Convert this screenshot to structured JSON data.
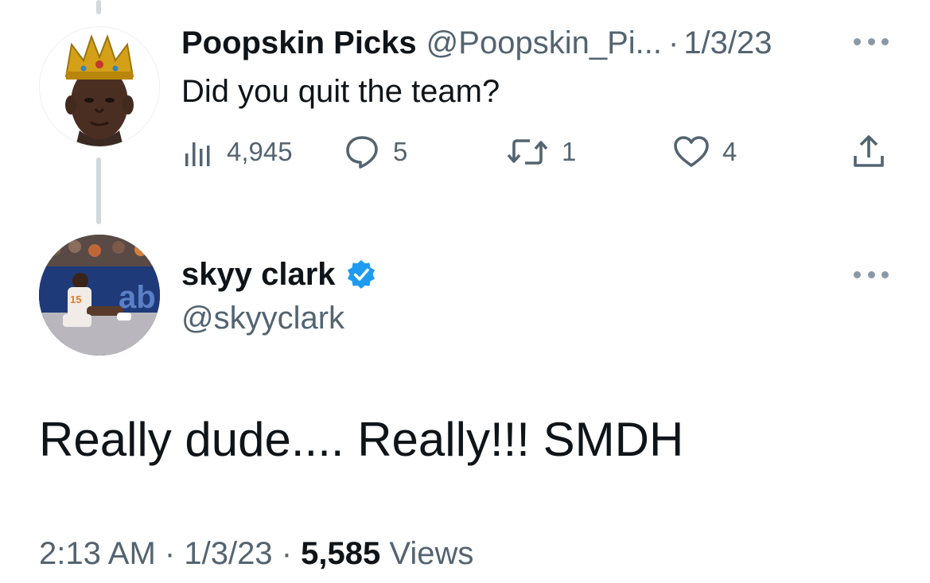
{
  "reply_tweet": {
    "author_name": "Poopskin Picks",
    "author_handle": "@Poopskin_Pi...",
    "separator": "·",
    "date": "1/3/23",
    "text": "Did you quit the team?",
    "avatar_icon": "crowned-person-avatar",
    "actions": {
      "views": "4,945",
      "replies": "5",
      "retweets": "1",
      "likes": "4"
    }
  },
  "main_tweet": {
    "author_name": "skyy clark",
    "author_handle": "@skyyclark",
    "verified": true,
    "avatar_icon": "basketball-player-avatar",
    "text": "Really dude.... Really!!! SMDH",
    "time": "2:13 AM",
    "separator": "·",
    "date": "1/3/23",
    "views_count": "5,585",
    "views_label": "Views"
  },
  "colors": {
    "text_primary": "#0f1419",
    "text_secondary": "#536471",
    "verified_blue": "#1d9bf0",
    "thread_line": "#cfd9de"
  }
}
